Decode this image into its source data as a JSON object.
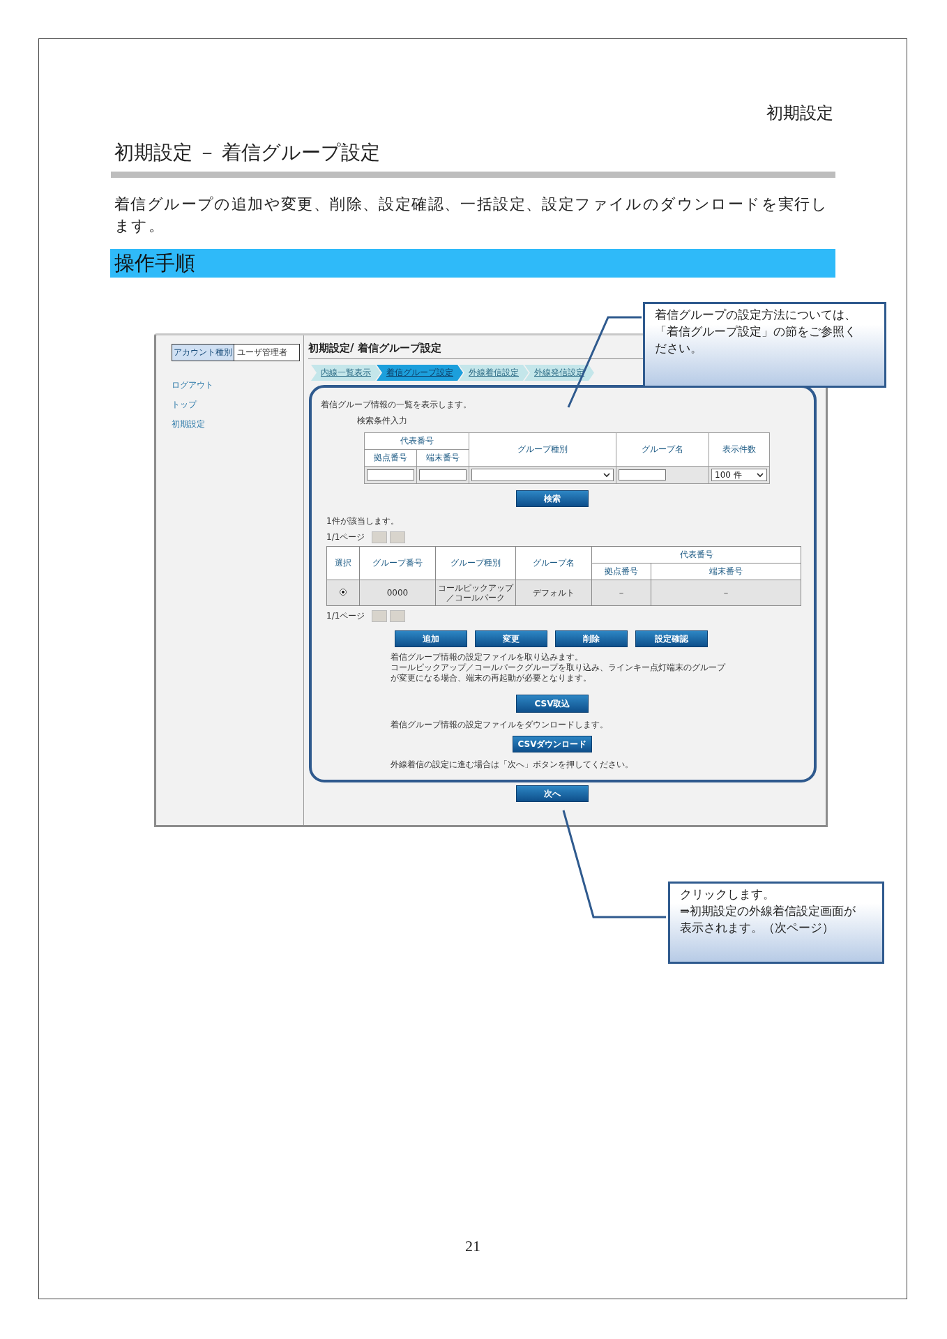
{
  "running_header": "初期設定",
  "title": "初期設定 － 着信グループ設定",
  "description": "着信グループの追加や変更、削除、設定確認、一括設定、設定ファイルのダウンロードを実行します。",
  "section_heading": "操作手順",
  "app": {
    "account": {
      "label": "アカウント種別",
      "value": "ユーザ管理者"
    },
    "nav": [
      "ログアウト",
      "トップ",
      "初期設定"
    ],
    "page_title": "初期設定/ 着信グループ設定",
    "tabs": [
      {
        "label": "内線一覧表示",
        "selected": false
      },
      {
        "label": "着信グループ設定",
        "selected": true
      },
      {
        "label": "外線着信設定",
        "selected": false
      },
      {
        "label": "外線発信設定",
        "selected": false
      }
    ],
    "intro": "着信グループ情報の一覧を表示します。",
    "search_label": "検索条件入力",
    "search": {
      "group_header": "代表番号",
      "sub_headers": [
        "拠点番号",
        "端末番号"
      ],
      "headers": [
        "グループ種別",
        "グループ名",
        "表示件数"
      ],
      "count_value": "100 件"
    },
    "search_button": "検索",
    "result_count": "1件が該当します。",
    "pager_top": {
      "label": "1/1ページ",
      "disabled": true
    },
    "results": {
      "headers": [
        "選択",
        "グループ番号",
        "グループ種別",
        "グループ名"
      ],
      "group_header": "代表番号",
      "sub_headers": [
        "拠点番号",
        "端末番号"
      ],
      "rows": [
        {
          "selected": true,
          "cells": [
            "0000",
            "コールピックアップ／コールパーク",
            "デフォルト",
            "－",
            "－"
          ]
        }
      ]
    },
    "pager_bottom": {
      "label": "1/1ページ",
      "disabled": true
    },
    "action_buttons": [
      "追加",
      "変更",
      "削除",
      "設定確認"
    ],
    "import_note": [
      "着信グループ情報の設定ファイルを取り込みます。",
      "コールピックアップ／コールパークグループを取り込み、ラインキー点灯端末のグループが変更になる場合、端末の再起動が必要となります。"
    ],
    "csv_import": "CSV取込",
    "download_note": "着信グループ情報の設定ファイルをダウンロードします。",
    "csv_download": "CSVダウンロード",
    "next_note": "外線着信の設定に進む場合は「次へ」ボタンを押してください。",
    "next_button": "次へ"
  },
  "callouts": [
    {
      "paragraphs": [
        "着信グループの設定方法については、「着信グループ設定」の節をご参照ください。"
      ]
    },
    {
      "paragraphs": [
        "クリックします。",
        "⇒初期設定の外線着信設定画面が表示されます。（次ページ）"
      ]
    }
  ],
  "page_number": "21"
}
